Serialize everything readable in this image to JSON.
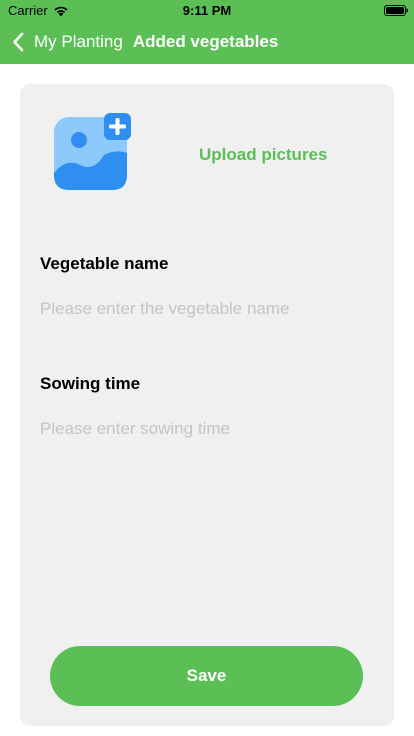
{
  "status_bar": {
    "carrier": "Carrier",
    "time": "9:11 PM"
  },
  "nav": {
    "back_label": "My Planting",
    "title": "Added vegetables"
  },
  "upload": {
    "label": "Upload pictures",
    "icon": "image-add-icon"
  },
  "form": {
    "vegetable_name": {
      "label": "Vegetable name",
      "value": "",
      "placeholder": "Please enter the vegetable name"
    },
    "sowing_time": {
      "label": "Sowing time",
      "value": "",
      "placeholder": "Please enter sowing time"
    }
  },
  "save_label": "Save",
  "colors": {
    "accent": "#5bbf55",
    "card_background": "#f0f0f0",
    "placeholder": "#c4c4c4",
    "icon_blue": "#2e8ff0",
    "icon_light_blue": "#8ec9fb"
  }
}
